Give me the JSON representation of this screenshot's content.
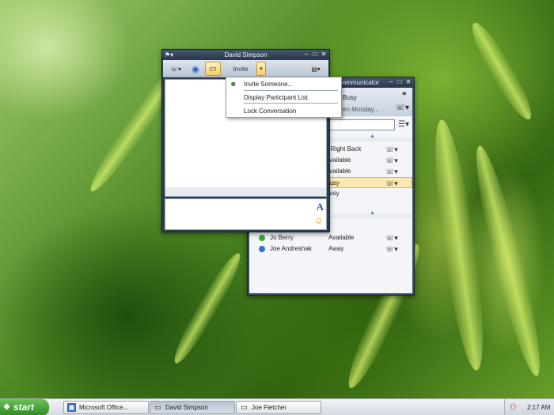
{
  "conversation_window": {
    "title": "David Simpson",
    "invite_label": "Invite",
    "menu": {
      "items": [
        "Invite Someone...",
        "Display Participant List",
        "Lock Conversation"
      ]
    }
  },
  "communicator_window": {
    "title_partial": "Communicator",
    "my_status": "Busy",
    "note_partial": "en Monday...",
    "groups": [
      {
        "contacts": [
          {
            "name_partial": "e Right Back",
            "status": "",
            "color": "#e0b020"
          },
          {
            "name_partial": "",
            "status": "Available",
            "color": "#3aa53a"
          },
          {
            "name_partial": "",
            "status": "Available",
            "color": "#3aa53a"
          },
          {
            "name_partial": "",
            "status": "Busy",
            "color": "#d03030",
            "selected": true
          },
          {
            "name_partial": "",
            "status": "Busy",
            "color": "#d03030"
          }
        ]
      },
      {
        "contacts": [
          {
            "name": "Jo Berry",
            "status": "Available",
            "color": "#3aa53a"
          },
          {
            "name": "Joe Andreshak",
            "status": "Away",
            "color": "#3a6fd0"
          }
        ]
      }
    ]
  },
  "taskbar": {
    "start_label": "start",
    "tasks": [
      {
        "label": "Microsoft Office...",
        "icon": "office-icon",
        "active": false
      },
      {
        "label": "David Simpson",
        "icon": "conversation-icon",
        "active": true
      },
      {
        "label": "Joe Fletcher",
        "icon": "conversation-icon",
        "active": false
      }
    ],
    "clock": "2:17 AM"
  }
}
